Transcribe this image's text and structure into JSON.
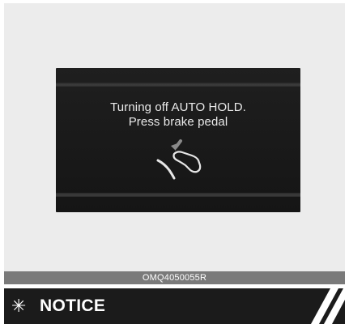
{
  "display": {
    "line1": "Turning off AUTO HOLD.",
    "line2": "Press brake pedal",
    "pedal_icon": "brake-pedal-icon"
  },
  "figure_code": "OMQ4050055R",
  "notice": {
    "symbol": "✳",
    "title": "NOTICE"
  },
  "colors": {
    "screen_bg": "#1b1b1b",
    "panel_bg": "#ececec",
    "caption_bg": "#7a7a7a",
    "notice_bg": "#1b1b1b"
  }
}
